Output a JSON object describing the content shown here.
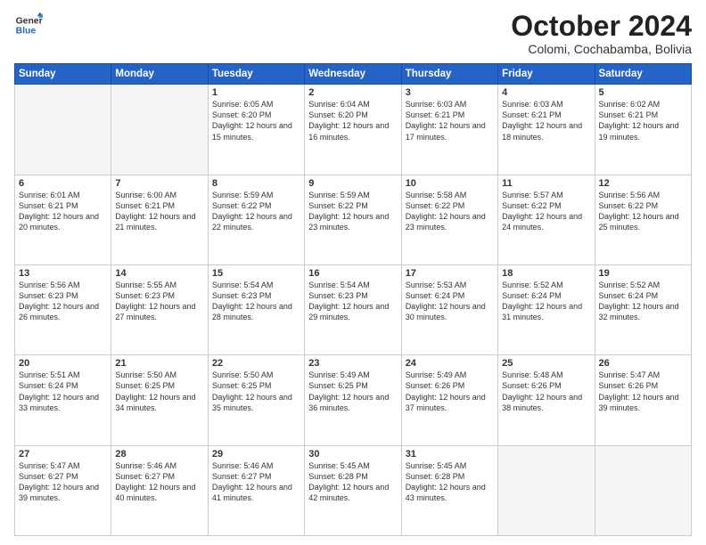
{
  "logo": {
    "general": "General",
    "blue": "Blue"
  },
  "header": {
    "month": "October 2024",
    "location": "Colomi, Cochabamba, Bolivia"
  },
  "days_of_week": [
    "Sunday",
    "Monday",
    "Tuesday",
    "Wednesday",
    "Thursday",
    "Friday",
    "Saturday"
  ],
  "weeks": [
    [
      {
        "day": "",
        "empty": true
      },
      {
        "day": "",
        "empty": true
      },
      {
        "day": "1",
        "sunrise": "6:05 AM",
        "sunset": "6:20 PM",
        "daylight": "12 hours and 15 minutes."
      },
      {
        "day": "2",
        "sunrise": "6:04 AM",
        "sunset": "6:20 PM",
        "daylight": "12 hours and 16 minutes."
      },
      {
        "day": "3",
        "sunrise": "6:03 AM",
        "sunset": "6:21 PM",
        "daylight": "12 hours and 17 minutes."
      },
      {
        "day": "4",
        "sunrise": "6:03 AM",
        "sunset": "6:21 PM",
        "daylight": "12 hours and 18 minutes."
      },
      {
        "day": "5",
        "sunrise": "6:02 AM",
        "sunset": "6:21 PM",
        "daylight": "12 hours and 19 minutes."
      }
    ],
    [
      {
        "day": "6",
        "sunrise": "6:01 AM",
        "sunset": "6:21 PM",
        "daylight": "12 hours and 20 minutes."
      },
      {
        "day": "7",
        "sunrise": "6:00 AM",
        "sunset": "6:21 PM",
        "daylight": "12 hours and 21 minutes."
      },
      {
        "day": "8",
        "sunrise": "5:59 AM",
        "sunset": "6:22 PM",
        "daylight": "12 hours and 22 minutes."
      },
      {
        "day": "9",
        "sunrise": "5:59 AM",
        "sunset": "6:22 PM",
        "daylight": "12 hours and 23 minutes."
      },
      {
        "day": "10",
        "sunrise": "5:58 AM",
        "sunset": "6:22 PM",
        "daylight": "12 hours and 23 minutes."
      },
      {
        "day": "11",
        "sunrise": "5:57 AM",
        "sunset": "6:22 PM",
        "daylight": "12 hours and 24 minutes."
      },
      {
        "day": "12",
        "sunrise": "5:56 AM",
        "sunset": "6:22 PM",
        "daylight": "12 hours and 25 minutes."
      }
    ],
    [
      {
        "day": "13",
        "sunrise": "5:56 AM",
        "sunset": "6:23 PM",
        "daylight": "12 hours and 26 minutes."
      },
      {
        "day": "14",
        "sunrise": "5:55 AM",
        "sunset": "6:23 PM",
        "daylight": "12 hours and 27 minutes."
      },
      {
        "day": "15",
        "sunrise": "5:54 AM",
        "sunset": "6:23 PM",
        "daylight": "12 hours and 28 minutes."
      },
      {
        "day": "16",
        "sunrise": "5:54 AM",
        "sunset": "6:23 PM",
        "daylight": "12 hours and 29 minutes."
      },
      {
        "day": "17",
        "sunrise": "5:53 AM",
        "sunset": "6:24 PM",
        "daylight": "12 hours and 30 minutes."
      },
      {
        "day": "18",
        "sunrise": "5:52 AM",
        "sunset": "6:24 PM",
        "daylight": "12 hours and 31 minutes."
      },
      {
        "day": "19",
        "sunrise": "5:52 AM",
        "sunset": "6:24 PM",
        "daylight": "12 hours and 32 minutes."
      }
    ],
    [
      {
        "day": "20",
        "sunrise": "5:51 AM",
        "sunset": "6:24 PM",
        "daylight": "12 hours and 33 minutes."
      },
      {
        "day": "21",
        "sunrise": "5:50 AM",
        "sunset": "6:25 PM",
        "daylight": "12 hours and 34 minutes."
      },
      {
        "day": "22",
        "sunrise": "5:50 AM",
        "sunset": "6:25 PM",
        "daylight": "12 hours and 35 minutes."
      },
      {
        "day": "23",
        "sunrise": "5:49 AM",
        "sunset": "6:25 PM",
        "daylight": "12 hours and 36 minutes."
      },
      {
        "day": "24",
        "sunrise": "5:49 AM",
        "sunset": "6:26 PM",
        "daylight": "12 hours and 37 minutes."
      },
      {
        "day": "25",
        "sunrise": "5:48 AM",
        "sunset": "6:26 PM",
        "daylight": "12 hours and 38 minutes."
      },
      {
        "day": "26",
        "sunrise": "5:47 AM",
        "sunset": "6:26 PM",
        "daylight": "12 hours and 39 minutes."
      }
    ],
    [
      {
        "day": "27",
        "sunrise": "5:47 AM",
        "sunset": "6:27 PM",
        "daylight": "12 hours and 39 minutes."
      },
      {
        "day": "28",
        "sunrise": "5:46 AM",
        "sunset": "6:27 PM",
        "daylight": "12 hours and 40 minutes."
      },
      {
        "day": "29",
        "sunrise": "5:46 AM",
        "sunset": "6:27 PM",
        "daylight": "12 hours and 41 minutes."
      },
      {
        "day": "30",
        "sunrise": "5:45 AM",
        "sunset": "6:28 PM",
        "daylight": "12 hours and 42 minutes."
      },
      {
        "day": "31",
        "sunrise": "5:45 AM",
        "sunset": "6:28 PM",
        "daylight": "12 hours and 43 minutes."
      },
      {
        "day": "",
        "empty": true
      },
      {
        "day": "",
        "empty": true
      }
    ]
  ],
  "labels": {
    "sunrise": "Sunrise:",
    "sunset": "Sunset:",
    "daylight": "Daylight:"
  }
}
